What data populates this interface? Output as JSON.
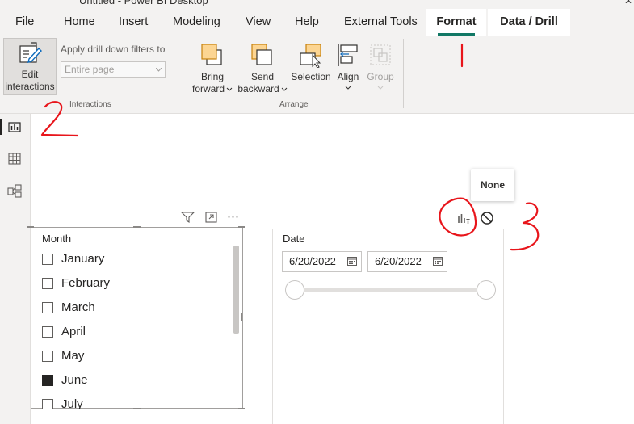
{
  "window": {
    "title": "Untitled - Power BI Desktop",
    "close_glyph": "✕"
  },
  "tabs": [
    {
      "label": "File"
    },
    {
      "label": "Home"
    },
    {
      "label": "Insert"
    },
    {
      "label": "Modeling"
    },
    {
      "label": "View"
    },
    {
      "label": "Help"
    },
    {
      "label": "External Tools"
    },
    {
      "label": "Format"
    },
    {
      "label": "Data / Drill"
    }
  ],
  "active_tab": "Format",
  "ribbon": {
    "edit_interactions_line1": "Edit",
    "edit_interactions_line2": "interactions",
    "apply_drill_label": "Apply drill down filters to",
    "apply_drill_value": "Entire page",
    "group_interactions": "Interactions",
    "bring_forward_1": "Bring",
    "bring_forward_2": "forward",
    "send_backward_1": "Send",
    "send_backward_2": "backward",
    "selection": "Selection",
    "align": "Align",
    "group": "Group",
    "group_arrange": "Arrange"
  },
  "tooltip": {
    "text": "None"
  },
  "month_slicer": {
    "title": "Month",
    "items": [
      {
        "label": "January",
        "checked": false
      },
      {
        "label": "February",
        "checked": false
      },
      {
        "label": "March",
        "checked": false
      },
      {
        "label": "April",
        "checked": false
      },
      {
        "label": "May",
        "checked": false
      },
      {
        "label": "June",
        "checked": true
      },
      {
        "label": "July",
        "checked": false
      }
    ]
  },
  "date_slicer": {
    "title": "Date",
    "start_date": "6/20/2022",
    "end_date": "6/20/2022"
  },
  "annotations": {
    "color": "#e8151b",
    "numbers": [
      "1",
      "2",
      "3"
    ]
  },
  "colors": {
    "accent": "#117865",
    "ribbon_bg": "#f3f2f1",
    "annotation": "#e8151b"
  }
}
